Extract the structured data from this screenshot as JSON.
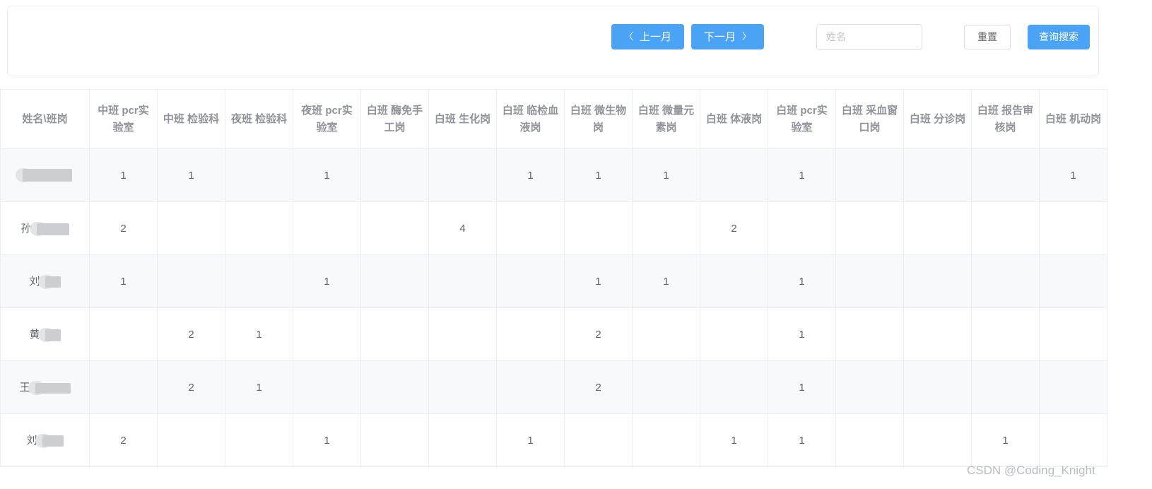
{
  "toolbar": {
    "prev_month_label": "上一月",
    "next_month_label": "下一月",
    "prev_arrow": "〈",
    "next_arrow": "〉",
    "name_input_value": "",
    "name_input_placeholder": "姓名",
    "reset_label": "重置",
    "search_label": "查询搜索",
    "primary_color": "#4aa3f5"
  },
  "table": {
    "headers": [
      "姓名\\班岗",
      "中班 pcr实验室",
      "中班 检验科",
      "夜班 检验科",
      "夜班 pcr实验室",
      "白班 酶免手工岗",
      "白班 生化岗",
      "白班 临检血液岗",
      "白班 微生物岗",
      "白班 微量元素岗",
      "白班 体液岗",
      "白班 pcr实验室",
      "白班 采血窗口岗",
      "白班 分诊岗",
      "白班 报告审核岗",
      "白班 机动岗"
    ],
    "rows": [
      {
        "name": "",
        "name_redacted": true,
        "name_prefix": "",
        "values": [
          "1",
          "1",
          "",
          "1",
          "",
          "",
          "1",
          "1",
          "1",
          "",
          "1",
          "",
          "",
          "",
          "1"
        ]
      },
      {
        "name": "孙",
        "name_redacted": true,
        "name_prefix": "孙",
        "values": [
          "2",
          "",
          "",
          "",
          "",
          "4",
          "",
          "",
          "",
          "2",
          "",
          "",
          "",
          "",
          ""
        ]
      },
      {
        "name": "刘",
        "name_redacted": true,
        "name_prefix": "刘",
        "values": [
          "1",
          "",
          "",
          "1",
          "",
          "",
          "",
          "1",
          "1",
          "",
          "1",
          "",
          "",
          "",
          ""
        ]
      },
      {
        "name": "黄",
        "name_redacted": true,
        "name_prefix": "黄",
        "values": [
          "",
          "2",
          "1",
          "",
          "",
          "",
          "",
          "2",
          "",
          "",
          "1",
          "",
          "",
          "",
          ""
        ]
      },
      {
        "name": "王",
        "name_redacted": true,
        "name_prefix": "王",
        "values": [
          "",
          "2",
          "1",
          "",
          "",
          "",
          "",
          "2",
          "",
          "",
          "1",
          "",
          "",
          "",
          ""
        ]
      },
      {
        "name": "刘",
        "name_redacted": true,
        "name_prefix": "刘",
        "values": [
          "2",
          "",
          "",
          "1",
          "",
          "",
          "1",
          "",
          "",
          "1",
          "1",
          "",
          "",
          "1",
          ""
        ]
      }
    ]
  },
  "watermark": "CSDN @Coding_Knight"
}
